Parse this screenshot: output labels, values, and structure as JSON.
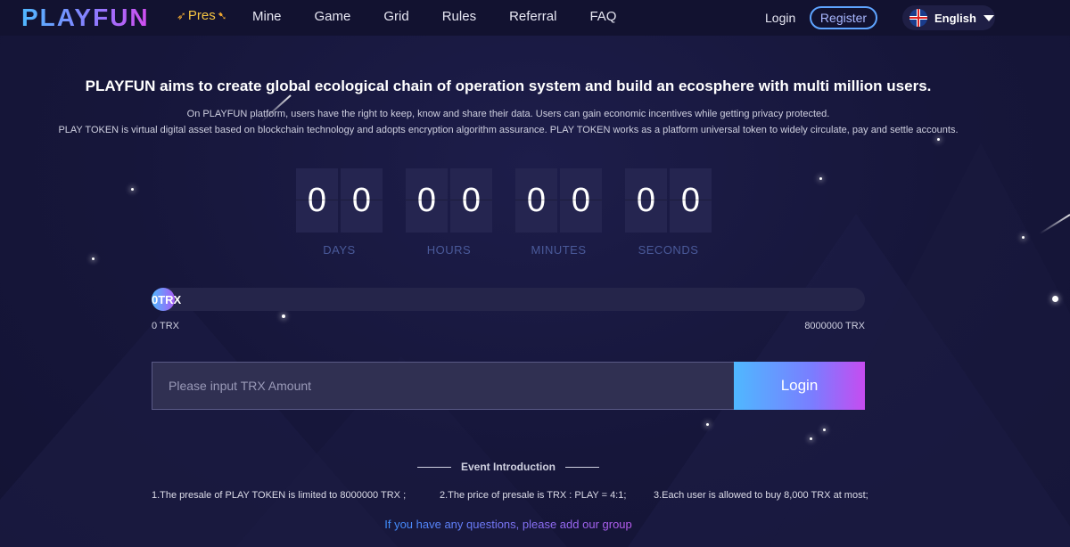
{
  "header": {
    "logo": "PLAYFUN",
    "badge": "Pres",
    "nav": [
      "Mine",
      "Game",
      "Grid",
      "Rules",
      "Referral",
      "FAQ"
    ],
    "login": "Login",
    "register": "Register",
    "language": "English"
  },
  "intro": {
    "headline": "PLAYFUN aims to create global ecological chain of operation system and build an ecosphere with multi million users.",
    "line1": "On PLAYFUN platform, users have the right to keep, know and share their data. Users can gain economic incentives while getting privacy protected.",
    "line2": "PLAY TOKEN is virtual digital asset based on blockchain technology and adopts encryption algorithm assurance. PLAY TOKEN works as a platform universal token to widely circulate, pay and settle accounts."
  },
  "countdown": {
    "days": [
      "0",
      "0"
    ],
    "hours": [
      "0",
      "0"
    ],
    "minutes": [
      "0",
      "0"
    ],
    "seconds": [
      "0",
      "0"
    ],
    "labels": {
      "days": "DAYS",
      "hours": "HOURS",
      "minutes": "MINUTES",
      "seconds": "SECONDS"
    }
  },
  "progress": {
    "value_label": "0TRX",
    "fraction": 0,
    "min_label": "0 TRX",
    "max_label": "8000000 TRX"
  },
  "purchase": {
    "placeholder": "Please input TRX Amount",
    "button": "Login"
  },
  "event": {
    "title": "Event Introduction",
    "items": [
      "1.The presale of PLAY TOKEN is limited to 8000000 TRX ;",
      "2.The price of presale is TRX : PLAY = 4:1;",
      "3.Each user is allowed to buy 8,000 TRX at most;"
    ],
    "contact": "If you have any questions, please add our group"
  },
  "colors": {
    "background": "#16163a",
    "accent_start": "#4fb8ff",
    "accent_end": "#c64cf0",
    "countdown_label": "#4a5a9a"
  }
}
